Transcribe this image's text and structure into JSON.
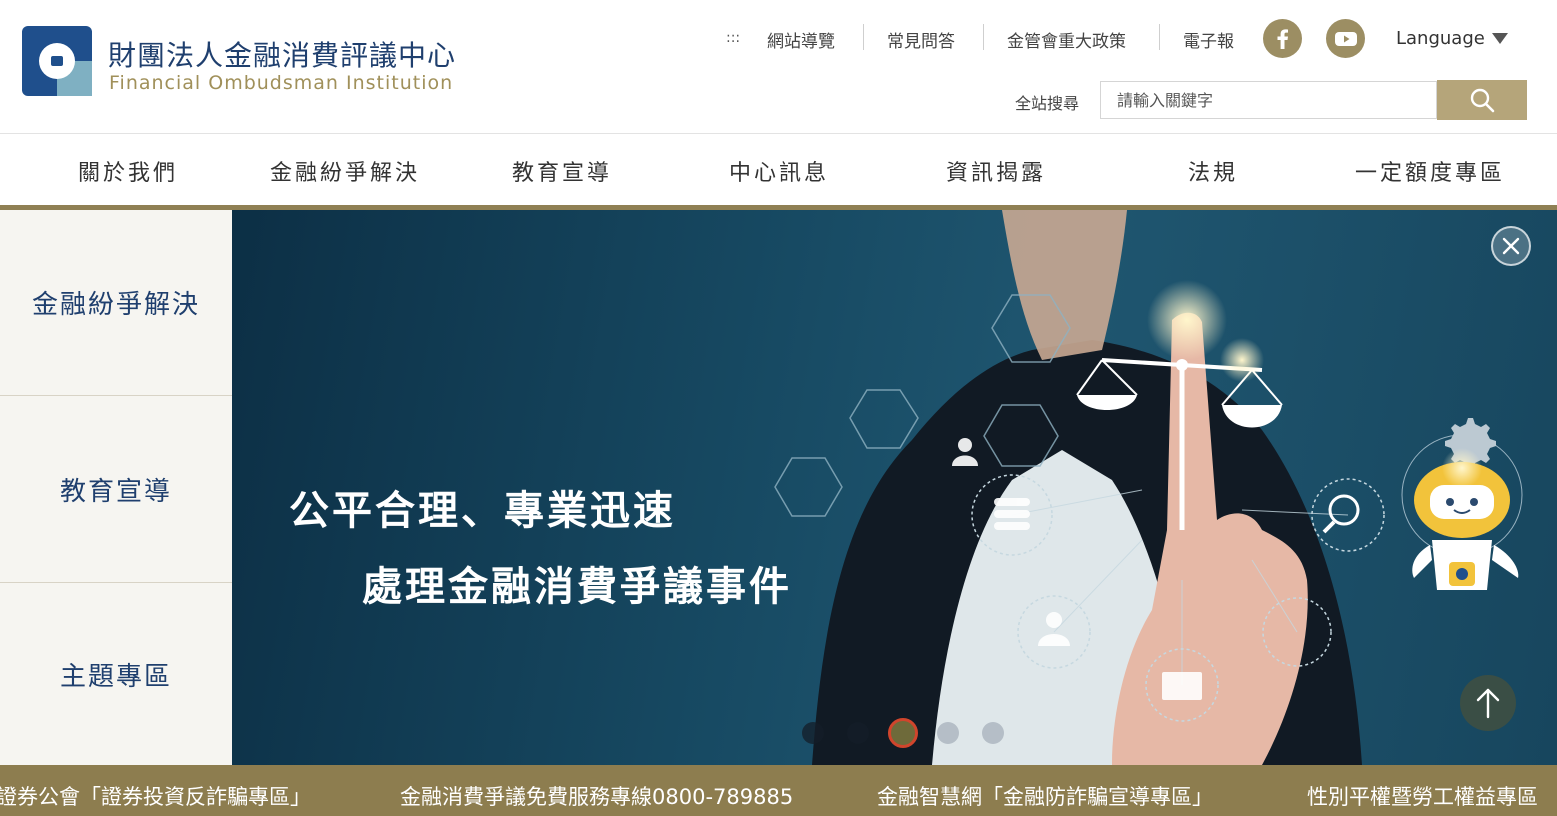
{
  "brand": {
    "name_cn": "財團法人金融消費評議中心",
    "name_en": "Financial  Ombudsman  Institution",
    "colors": {
      "navy": "#1f3f6e",
      "gold": "#9c8e63"
    }
  },
  "utility": {
    "sitemap_icon": ":::",
    "links": [
      "網站導覽",
      "常見問答",
      "金管會重大政策",
      "電子報"
    ],
    "social": [
      "facebook-icon",
      "youtube-icon"
    ],
    "language_label": "Language"
  },
  "search": {
    "label": "全站搜尋",
    "placeholder": "請輸入關鍵字"
  },
  "nav": {
    "items": [
      "關於我們",
      "金融紛爭解決",
      "教育宣導",
      "中心訊息",
      "資訊揭露",
      "法規",
      "一定額度專區"
    ]
  },
  "sidebar": {
    "items": [
      "金融紛爭解決",
      "教育宣導",
      "主題專區"
    ]
  },
  "banner": {
    "line1": "公平合理、專業迅速",
    "line2": "處理金融消費爭議事件",
    "slide_count": 5,
    "active_slide": 3
  },
  "ticker": {
    "items": [
      "證券公會「證券投資反詐騙專區」",
      "金融消費爭議免費服務專線0800-789885",
      "金融智慧網「金融防詐騙宣導專區」",
      "性別平權暨勞工權益專區"
    ]
  }
}
